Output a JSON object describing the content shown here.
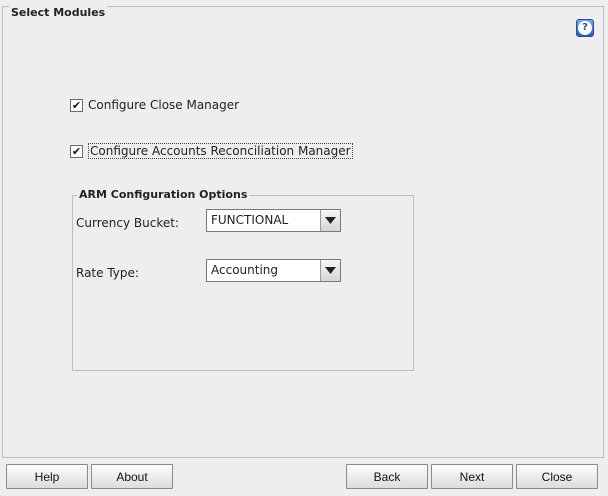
{
  "panel": {
    "title": "Select Modules",
    "help_glyph": "?"
  },
  "checkboxes": [
    {
      "label": "Configure Close Manager",
      "checked": true
    },
    {
      "label": "Configure Accounts Reconciliation Manager",
      "checked": true
    }
  ],
  "arm_options": {
    "title": "ARM Configuration Options",
    "currency_bucket": {
      "label": "Currency Bucket:",
      "value": "FUNCTIONAL"
    },
    "rate_type": {
      "label": "Rate Type:",
      "value": "Accounting"
    }
  },
  "buttons": {
    "help": "Help",
    "about": "About",
    "back": "Back",
    "next": "Next",
    "close": "Close"
  },
  "icons": {
    "help": "help-question-icon",
    "check": "checkmark-icon",
    "dropdown": "dropdown-arrow-icon"
  }
}
